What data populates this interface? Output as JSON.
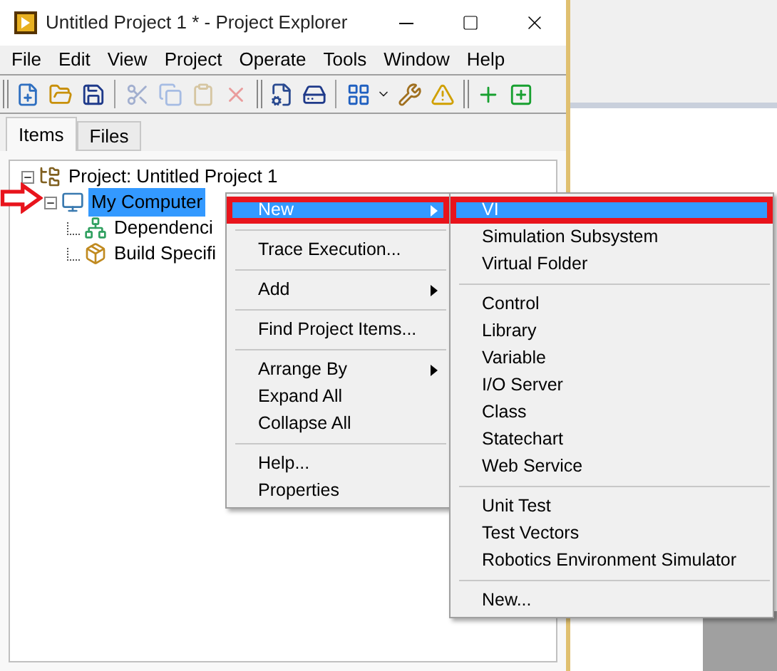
{
  "window": {
    "title": "Untitled Project 1 * - Project Explorer"
  },
  "menu_bar": [
    "File",
    "Edit",
    "View",
    "Project",
    "Operate",
    "Tools",
    "Window",
    "Help"
  ],
  "toolbar": [
    {
      "kind": "new",
      "disabled": false
    },
    {
      "kind": "open",
      "disabled": false
    },
    {
      "kind": "save",
      "disabled": false
    },
    {
      "kind": "separator"
    },
    {
      "kind": "cut",
      "disabled": true
    },
    {
      "kind": "copy",
      "disabled": true
    },
    {
      "kind": "paste",
      "disabled": true
    },
    {
      "kind": "delete",
      "disabled": true
    },
    {
      "kind": "group"
    },
    {
      "kind": "build",
      "disabled": false
    },
    {
      "kind": "deploy",
      "disabled": false
    },
    {
      "kind": "separator"
    },
    {
      "kind": "view",
      "disabled": false
    },
    {
      "kind": "dropdown",
      "disabled": false
    },
    {
      "kind": "tools",
      "disabled": false
    },
    {
      "kind": "warning",
      "disabled": false
    },
    {
      "kind": "group"
    },
    {
      "kind": "add-run",
      "disabled": false
    },
    {
      "kind": "add-window",
      "disabled": false
    }
  ],
  "tabs": [
    {
      "label": "Items",
      "selected": true
    },
    {
      "label": "Files",
      "selected": false
    }
  ],
  "tree": [
    {
      "label": "Project: Untitled Project 1",
      "kind": "project",
      "expanded": true,
      "selected": false,
      "children": [
        {
          "label": "My Computer",
          "kind": "computer",
          "expanded": true,
          "selected": true,
          "children": [
            {
              "label": "Dependenci",
              "kind": "dependencies",
              "selected": false
            },
            {
              "label": "Build Specifi",
              "kind": "build",
              "selected": false
            }
          ]
        }
      ]
    }
  ],
  "context_menu": [
    {
      "kind": "item",
      "label": "New",
      "submenu": true,
      "selected": true,
      "annotated": true
    },
    {
      "kind": "separator"
    },
    {
      "kind": "item",
      "label": "Trace Execution...",
      "submenu": false,
      "selected": false,
      "annotated": false
    },
    {
      "kind": "separator"
    },
    {
      "kind": "item",
      "label": "Add",
      "submenu": true,
      "selected": false,
      "annotated": false
    },
    {
      "kind": "separator"
    },
    {
      "kind": "item",
      "label": "Find Project Items...",
      "submenu": false,
      "selected": false,
      "annotated": false
    },
    {
      "kind": "separator"
    },
    {
      "kind": "item",
      "label": "Arrange By",
      "submenu": true,
      "selected": false,
      "annotated": false
    },
    {
      "kind": "item",
      "label": "Expand All",
      "submenu": false,
      "selected": false,
      "annotated": false
    },
    {
      "kind": "item",
      "label": "Collapse All",
      "submenu": false,
      "selected": false,
      "annotated": false
    },
    {
      "kind": "separator"
    },
    {
      "kind": "item",
      "label": "Help...",
      "submenu": false,
      "selected": false,
      "annotated": false
    },
    {
      "kind": "item",
      "label": "Properties",
      "submenu": false,
      "selected": false,
      "annotated": false
    }
  ],
  "submenu": [
    {
      "kind": "item",
      "label": "VI",
      "submenu": false,
      "selected": true,
      "annotated": true
    },
    {
      "kind": "item",
      "label": "Simulation Subsystem",
      "submenu": false,
      "selected": false,
      "annotated": false
    },
    {
      "kind": "item",
      "label": "Virtual Folder",
      "submenu": false,
      "selected": false,
      "annotated": false
    },
    {
      "kind": "separator"
    },
    {
      "kind": "item",
      "label": "Control",
      "submenu": false,
      "selected": false,
      "annotated": false
    },
    {
      "kind": "item",
      "label": "Library",
      "submenu": false,
      "selected": false,
      "annotated": false
    },
    {
      "kind": "item",
      "label": "Variable",
      "submenu": false,
      "selected": false,
      "annotated": false
    },
    {
      "kind": "item",
      "label": "I/O Server",
      "submenu": false,
      "selected": false,
      "annotated": false
    },
    {
      "kind": "item",
      "label": "Class",
      "submenu": false,
      "selected": false,
      "annotated": false
    },
    {
      "kind": "item",
      "label": "Statechart",
      "submenu": false,
      "selected": false,
      "annotated": false
    },
    {
      "kind": "item",
      "label": "Web Service",
      "submenu": false,
      "selected": false,
      "annotated": false
    },
    {
      "kind": "separator"
    },
    {
      "kind": "item",
      "label": "Unit Test",
      "submenu": false,
      "selected": false,
      "annotated": false
    },
    {
      "kind": "item",
      "label": "Test Vectors",
      "submenu": false,
      "selected": false,
      "annotated": false
    },
    {
      "kind": "item",
      "label": "Robotics Environment Simulator",
      "submenu": false,
      "selected": false,
      "annotated": false
    },
    {
      "kind": "separator"
    },
    {
      "kind": "item",
      "label": "New...",
      "submenu": false,
      "selected": false,
      "annotated": false
    }
  ]
}
